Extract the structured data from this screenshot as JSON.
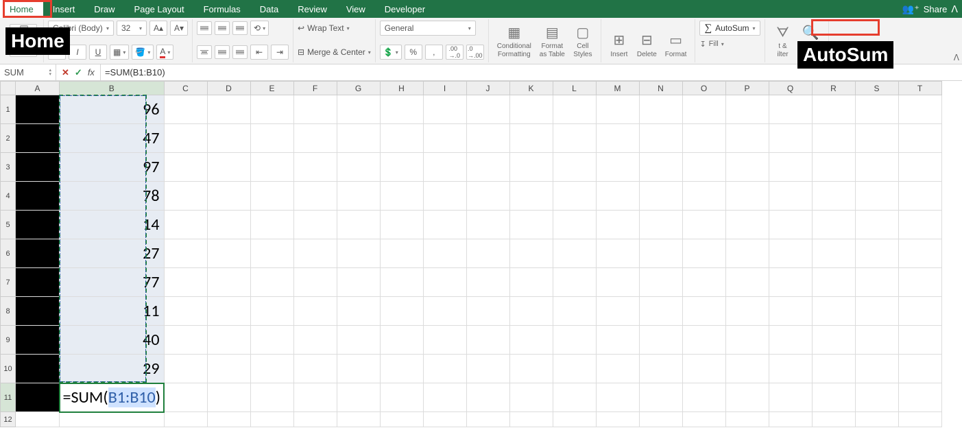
{
  "tabs": [
    "Home",
    "Insert",
    "Draw",
    "Page Layout",
    "Formulas",
    "Data",
    "Review",
    "View",
    "Developer"
  ],
  "active_tab": "Home",
  "share": {
    "label": "Share"
  },
  "ribbon": {
    "font_name": "Calibri (Body)",
    "font_size": "32",
    "wrap_text": "Wrap Text",
    "merge_center": "Merge & Center",
    "number_format": "General",
    "cond_fmt_1": "Conditional",
    "cond_fmt_2": "Formatting",
    "fmt_tbl_1": "Format",
    "fmt_tbl_2": "as Table",
    "cell_styles_1": "Cell",
    "cell_styles_2": "Styles",
    "insert": "Insert",
    "delete": "Delete",
    "format": "Format",
    "autosum": "AutoSum",
    "fill": "Fill",
    "sort_filter_1": "t &",
    "sort_filter_2": "ilter",
    "find_select_1": "Find &",
    "find_select_2": "Select"
  },
  "annotations": {
    "home_label": "Home",
    "autosum_label": "AutoSum"
  },
  "formula_bar": {
    "name_box": "SUM",
    "formula_text": "=SUM(B1:B10)"
  },
  "columns": [
    "A",
    "B",
    "C",
    "D",
    "E",
    "F",
    "G",
    "H",
    "I",
    "J",
    "K",
    "L",
    "M",
    "N",
    "O",
    "P",
    "Q",
    "R",
    "S",
    "T"
  ],
  "data_values": [
    "96",
    "47",
    "97",
    "78",
    "14",
    "27",
    "77",
    "11",
    "40",
    "29"
  ],
  "active_cell_formula": {
    "prefix": "=SUM(",
    "ref": "B1:B10",
    "suffix": ")"
  },
  "visible_rows": 12
}
